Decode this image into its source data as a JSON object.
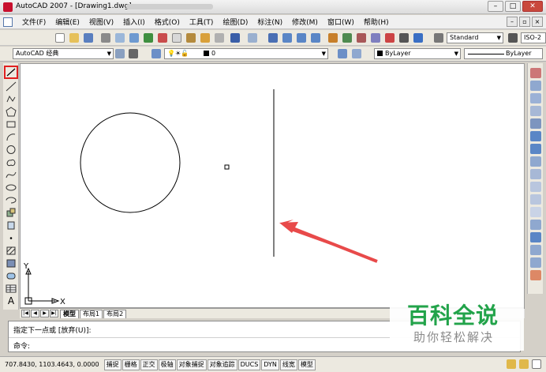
{
  "window": {
    "title": "AutoCAD 2007 - [Drawing1.dwg]"
  },
  "menu": {
    "items": [
      "文件(F)",
      "编辑(E)",
      "视图(V)",
      "插入(I)",
      "格式(O)",
      "工具(T)",
      "绘图(D)",
      "标注(N)",
      "修改(M)",
      "窗口(W)",
      "帮助(H)"
    ]
  },
  "toolbar": {
    "text_style": "Standard",
    "dim_style": "ISO-2",
    "workspace": "AutoCAD 经典",
    "layer": "0",
    "color": "ByLayer",
    "linetype": "ByLayer"
  },
  "layout_tabs": [
    "模型",
    "布局1",
    "布局2"
  ],
  "ucs": {
    "x_label": "X",
    "y_label": "Y"
  },
  "command": {
    "line1": "指定下一点或 [放弃(U)]:",
    "line2": "命令:"
  },
  "status": {
    "coords": "707.8430,  1103.4643, 0.0000",
    "buttons": [
      "捕捉",
      "栅格",
      "正交",
      "极轴",
      "对象捕捉",
      "对象追踪",
      "DUCS",
      "DYN",
      "线宽",
      "模型"
    ]
  },
  "watermark": {
    "main": "百科全说",
    "sub": "助你轻松解决"
  },
  "colors": {
    "accent_red": "#e02020",
    "watermark_green": "#22a34a"
  }
}
